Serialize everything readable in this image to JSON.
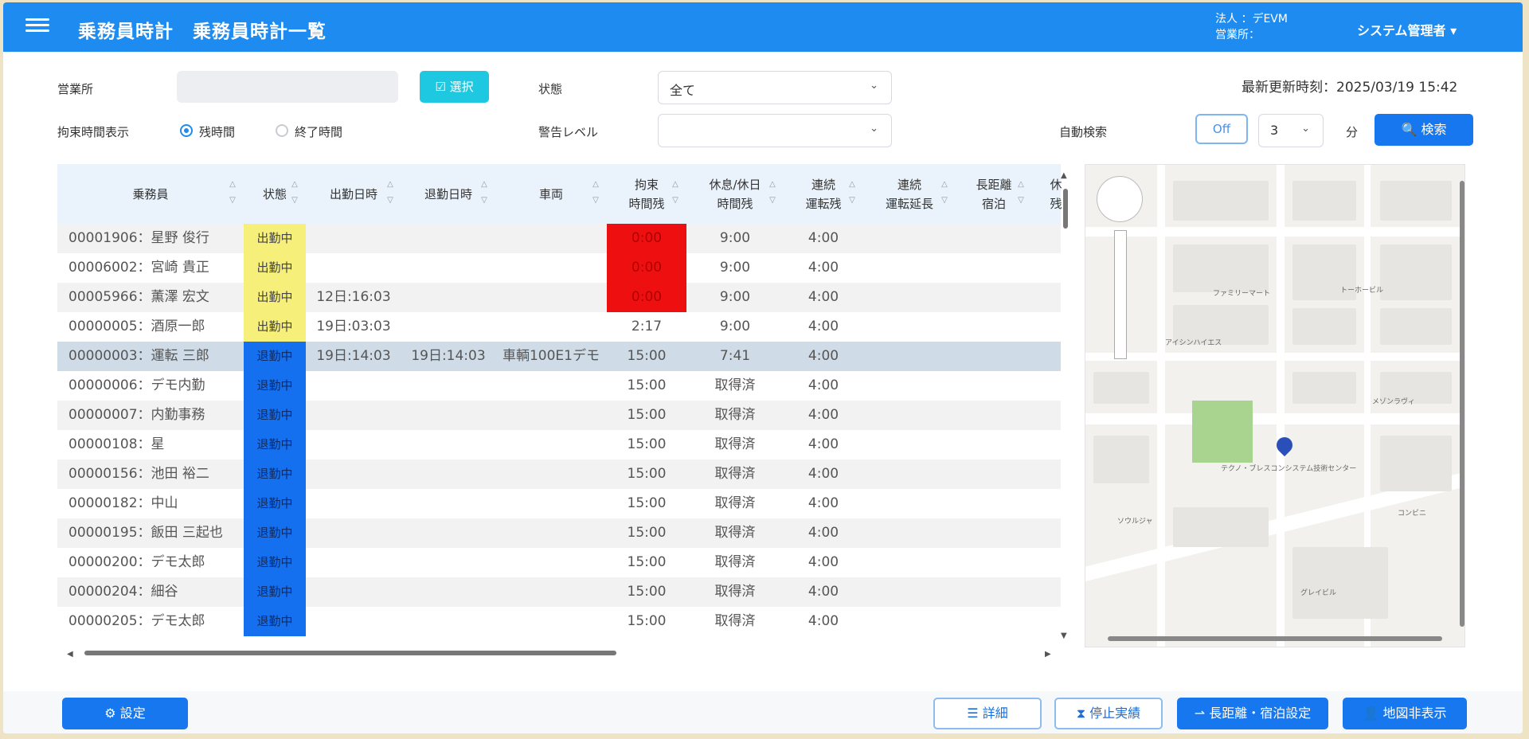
{
  "header": {
    "app_title": "乗務員時計",
    "page_title": "乗務員時計一覧",
    "corp_line": "法人 ：デEVM",
    "office_line": "営業所：",
    "user": "システム管理者 ▾"
  },
  "filters": {
    "office_label": "営業所",
    "select_button": "☑ 選択",
    "state_label": "状態",
    "state_value": "全て",
    "updated_label": "最新更新時刻：",
    "updated_value": "2025/03/19 15:42",
    "display_label": "拘束時間表示",
    "radio_remaining": "残時間",
    "radio_end": "終了時間",
    "warn_label": "警告レベル",
    "warn_value": "",
    "auto_label": "自動検索",
    "auto_toggle": "Off",
    "interval_value": "3",
    "interval_unit": "分",
    "search_button": "🔍 検索"
  },
  "table": {
    "columns": [
      {
        "line1": "乗務員",
        "line2": ""
      },
      {
        "line1": "状態",
        "line2": ""
      },
      {
        "line1": "出勤日時",
        "line2": ""
      },
      {
        "line1": "退勤日時",
        "line2": ""
      },
      {
        "line1": "車両",
        "line2": ""
      },
      {
        "line1": "拘束",
        "line2": "時間残"
      },
      {
        "line1": "休息/休日",
        "line2": "時間残"
      },
      {
        "line1": "連続",
        "line2": "運転残"
      },
      {
        "line1": "連続",
        "line2": "運転延長"
      },
      {
        "line1": "長距離",
        "line2": "宿泊"
      },
      {
        "line1": "休",
        "line2": "残"
      }
    ],
    "rows": [
      {
        "driver": "00001906：星野 俊行",
        "status": "出勤中",
        "status_type": "yellow",
        "start": "",
        "end": "",
        "vehicle": "",
        "bind": "0:00",
        "bind_red": true,
        "rest": "9:00",
        "cont": "4:00"
      },
      {
        "driver": "00006002：宮崎 貴正",
        "status": "出勤中",
        "status_type": "yellow",
        "start": "",
        "end": "",
        "vehicle": "",
        "bind": "0:00",
        "bind_red": true,
        "rest": "9:00",
        "cont": "4:00"
      },
      {
        "driver": "00005966：薫澤 宏文",
        "status": "出勤中",
        "status_type": "yellow",
        "start": "12日:16:03",
        "end": "",
        "vehicle": "",
        "bind": "0:00",
        "bind_red": true,
        "rest": "9:00",
        "cont": "4:00"
      },
      {
        "driver": "00000005：酒原一郎",
        "status": "出勤中",
        "status_type": "yellow",
        "start": "19日:03:03",
        "end": "",
        "vehicle": "",
        "bind": "2:17",
        "bind_red": false,
        "rest": "9:00",
        "cont": "4:00"
      },
      {
        "driver": "00000003：運転 三郎",
        "status": "退勤中",
        "status_type": "blue",
        "start": "19日:14:03",
        "end": "19日:14:03",
        "vehicle": "車輌100E1デモ",
        "bind": "15:00",
        "bind_red": false,
        "rest": "7:41",
        "cont": "4:00"
      },
      {
        "driver": "00000006：デモ内勤",
        "status": "退勤中",
        "status_type": "blue",
        "start": "",
        "end": "",
        "vehicle": "",
        "bind": "15:00",
        "bind_red": false,
        "rest": "取得済",
        "cont": "4:00"
      },
      {
        "driver": "00000007：内勤事務",
        "status": "退勤中",
        "status_type": "blue",
        "start": "",
        "end": "",
        "vehicle": "",
        "bind": "15:00",
        "bind_red": false,
        "rest": "取得済",
        "cont": "4:00"
      },
      {
        "driver": "00000108：星",
        "status": "退勤中",
        "status_type": "blue",
        "start": "",
        "end": "",
        "vehicle": "",
        "bind": "15:00",
        "bind_red": false,
        "rest": "取得済",
        "cont": "4:00"
      },
      {
        "driver": "00000156：池田 裕二",
        "status": "退勤中",
        "status_type": "blue",
        "start": "",
        "end": "",
        "vehicle": "",
        "bind": "15:00",
        "bind_red": false,
        "rest": "取得済",
        "cont": "4:00"
      },
      {
        "driver": "00000182：中山",
        "status": "退勤中",
        "status_type": "blue",
        "start": "",
        "end": "",
        "vehicle": "",
        "bind": "15:00",
        "bind_red": false,
        "rest": "取得済",
        "cont": "4:00"
      },
      {
        "driver": "00000195：飯田 三起也",
        "status": "退勤中",
        "status_type": "blue",
        "start": "",
        "end": "",
        "vehicle": "",
        "bind": "15:00",
        "bind_red": false,
        "rest": "取得済",
        "cont": "4:00"
      },
      {
        "driver": "00000200：デモ太郎",
        "status": "退勤中",
        "status_type": "blue",
        "start": "",
        "end": "",
        "vehicle": "",
        "bind": "15:00",
        "bind_red": false,
        "rest": "取得済",
        "cont": "4:00"
      },
      {
        "driver": "00000204：細谷",
        "status": "退勤中",
        "status_type": "blue",
        "start": "",
        "end": "",
        "vehicle": "",
        "bind": "15:00",
        "bind_red": false,
        "rest": "取得済",
        "cont": "4:00"
      },
      {
        "driver": "00000205：デモ太郎",
        "status": "退勤中",
        "status_type": "blue",
        "start": "",
        "end": "",
        "vehicle": "",
        "bind": "15:00",
        "bind_red": false,
        "rest": "取得済",
        "cont": "4:00"
      }
    ],
    "selected_row": 4
  },
  "map": {
    "labels": [
      "ファミリーマート",
      "アイシンハイエス",
      "メゾンラヴィ",
      "テクノ・ブレスコンシステム技術センター",
      "トーホービル",
      "ソウルジャ",
      "コンビニ",
      "グレイビル"
    ]
  },
  "footer": {
    "settings": "⚙ 設定",
    "detail": "☰ 詳細",
    "stop": "⧗ 停止実績",
    "longdist": "⇀ 長距離・宿泊設定",
    "map_toggle": "👤 地図非表示"
  },
  "colors": {
    "brand": "#1d8bf0",
    "status_working": "#f6f07a",
    "status_off": "#1570f0",
    "warn_red": "#ee1010"
  }
}
